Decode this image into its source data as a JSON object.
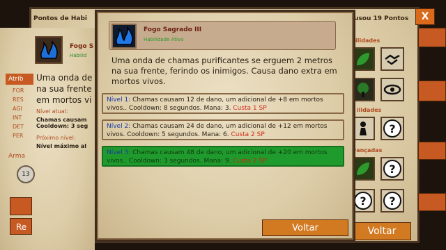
{
  "background": {
    "header_left": "Pontos de Habi",
    "header_right": "usou 19 Pontos",
    "close_label": "X",
    "skill_name": "Fogo S",
    "skill_sub": "Habilid",
    "desc_lines": [
      "Uma onda de",
      "na sua frente",
      "em mortos vi"
    ],
    "atrib_tab": "Atrib",
    "stats": [
      "FOR",
      "RES",
      "AGI",
      "INT",
      "DET",
      "PER"
    ],
    "current_level_label": "Nível atual:",
    "current_level_text": "Chamas causam\nCooldown: 3 seg",
    "next_level_label": "Próximo nível:",
    "next_level_text": "Nível máximo al",
    "arma_label": "Arma",
    "arma_badge": "13",
    "left_button_2": "Re",
    "right_labels": [
      "ilidades",
      "ilidades",
      "vançadas"
    ],
    "voltar": "Voltar"
  },
  "dialog": {
    "title": "Fogo Sagrado III",
    "subtitle": "Habilidade Ativa",
    "description": "Uma onda de chamas purificantes se erguem 2 metros na sua frente, ferindo os inimigos. Causa dano extra em mortos vivos.",
    "levels": [
      {
        "name": "Nível 1:",
        "text": "Chamas causam 12 de dano, um adicional de +8 em mortos vivos.. Cooldown: 8 segundos. Mana: 3.",
        "cost": "Custa 1 SP",
        "active": false
      },
      {
        "name": "Nível 2:",
        "text": "Chamas causam 24 de dano, um adicional de +12 em mortos vivos. Cooldown: 5 segundos. Mana: 6.",
        "cost": "Custa 2 SP",
        "active": false
      },
      {
        "name": "Nível 3:",
        "text": "Chamas causam 48 de dano, um adicional de +20 em mortos vivos.. Cooldown: 3 segundos. Mana: 9.",
        "cost": "Custa 2 SP",
        "active": true
      }
    ],
    "voltar": "Voltar"
  },
  "icons": {
    "skill": "blue-flame-icon",
    "hand": "handshake-icon",
    "tree": "tree-icon",
    "eye": "eye-icon",
    "pawn": "pawn-icon",
    "question": "question-mark-icon",
    "leaf": "leaf-icon"
  },
  "colors": {
    "accent_orange": "#d27a22",
    "active_green": "#1f9a2c",
    "level_blue": "#1a3aa8",
    "cost_red": "#d22a1a"
  }
}
